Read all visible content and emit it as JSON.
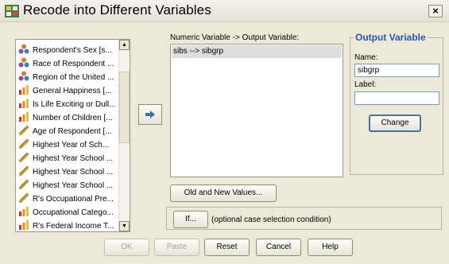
{
  "window": {
    "title": "Recode into Different Variables",
    "close_label": "×"
  },
  "source_list": {
    "items": [
      {
        "label": "Respondent's Sex [s...",
        "icon": "nominal-icon"
      },
      {
        "label": "Race of Respondent ...",
        "icon": "nominal-icon"
      },
      {
        "label": "Region of the United ...",
        "icon": "nominal-icon"
      },
      {
        "label": "General Happiness [...",
        "icon": "ordinal-icon"
      },
      {
        "label": "Is Life Exciting or Dull...",
        "icon": "ordinal-icon"
      },
      {
        "label": "Number of Children [...",
        "icon": "ordinal-icon"
      },
      {
        "label": "Age of Respondent [...",
        "icon": "scale-icon"
      },
      {
        "label": "Highest Year of Sch...",
        "icon": "scale-icon"
      },
      {
        "label": "Highest Year School ...",
        "icon": "scale-icon"
      },
      {
        "label": "Highest Year School ...",
        "icon": "scale-icon"
      },
      {
        "label": "Highest Year School ...",
        "icon": "scale-icon"
      },
      {
        "label": "R's Occupational Pre...",
        "icon": "scale-icon"
      },
      {
        "label": "Occupational Catego...",
        "icon": "ordinal-icon"
      },
      {
        "label": "R's Federal Income T...",
        "icon": "ordinal-icon"
      }
    ]
  },
  "numeric_variable": {
    "label": "Numeric Variable -> Output Variable:",
    "items": [
      "sibs --> sibgrp"
    ]
  },
  "output_variable": {
    "title": "Output Variable",
    "name_label": "Name:",
    "name_value": "sibgrp",
    "label_label": "Label:",
    "label_value": "",
    "change_button": "Change"
  },
  "old_new_button": "Old and New Values...",
  "if_section": {
    "button": "If...",
    "text": "(optional case selection condition)"
  },
  "footer_buttons": {
    "ok": "OK",
    "paste": "Paste",
    "reset": "Reset",
    "cancel": "Cancel",
    "help": "Help"
  },
  "colors": {
    "group_title": "#2b54a8",
    "nominal": "#d97a2b",
    "ordinal": "#c8342a",
    "scale": "#d6a72b"
  }
}
